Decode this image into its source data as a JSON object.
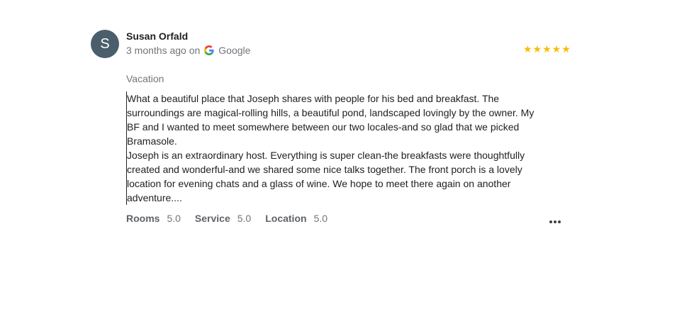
{
  "review": {
    "avatar_letter": "S",
    "author": "Susan Orfald",
    "time": "3 months ago on",
    "source": "Google",
    "stars": "★★★★★",
    "rating": 5,
    "trip_type": "Vacation",
    "paragraphs": [
      "What a beautiful place that Joseph shares with people for his bed and breakfast. The surroundings are magical-rolling hills, a beautiful pond, landscaped lovingly by the owner. My BF and I wanted to meet somewhere between our two locales-and so glad that we picked Bramasole.",
      "Joseph is an extraordinary host. Everything is super clean-the breakfasts were thoughtfully created and wonderful-and we shared some nice talks together. The front porch is a lovely location for evening chats and a glass of wine. We hope to meet there again on another adventure...."
    ],
    "sub_ratings": [
      {
        "label": "Rooms",
        "value": "5.0"
      },
      {
        "label": "Service",
        "value": "5.0"
      },
      {
        "label": "Location",
        "value": "5.0"
      }
    ]
  },
  "colors": {
    "avatar_bg": "#4a5f6b",
    "star": "#fbbc04",
    "text_primary": "#202124",
    "text_secondary": "#70757a"
  },
  "icons": {
    "source_logo": "google-g-icon",
    "more": "more-horizontal-icon"
  }
}
